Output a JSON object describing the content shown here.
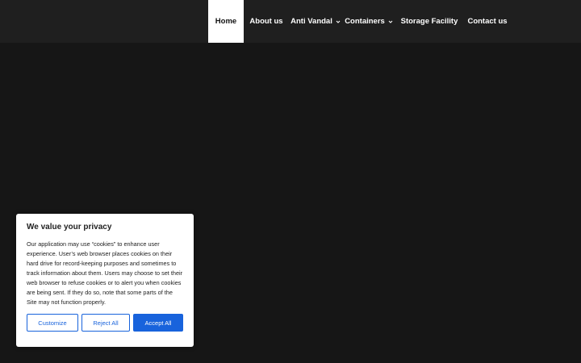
{
  "nav": {
    "items": [
      {
        "label": "Home",
        "active": true,
        "has_dropdown": false
      },
      {
        "label": "About us",
        "active": false,
        "has_dropdown": false
      },
      {
        "label": "Anti Vandal",
        "active": false,
        "has_dropdown": true
      },
      {
        "label": "Containers",
        "active": false,
        "has_dropdown": true
      },
      {
        "label": "Storage Facility",
        "active": false,
        "has_dropdown": false
      },
      {
        "label": "Contact us",
        "active": false,
        "has_dropdown": false
      }
    ],
    "dropdown_icon": "chevron-down-icon"
  },
  "cookie_banner": {
    "title": "We value your privacy",
    "body": "Our application may use “cookies” to enhance user experience. User’s web browser places cookies on their hard drive for record-keeping purposes and sometimes to track information about them. Users may choose to set their web browser to refuse cookies or to alert you when cookies are being sent. If they do so, note that some parts of the Site may not function properly.",
    "customize_label": "Customize",
    "reject_label": "Reject All",
    "accept_label": "Accept All"
  },
  "colors": {
    "accent": "#1863dc",
    "header_bg": "#1f1f1f",
    "page_bg": "#161616",
    "nav_active_bg": "#ffffff"
  }
}
